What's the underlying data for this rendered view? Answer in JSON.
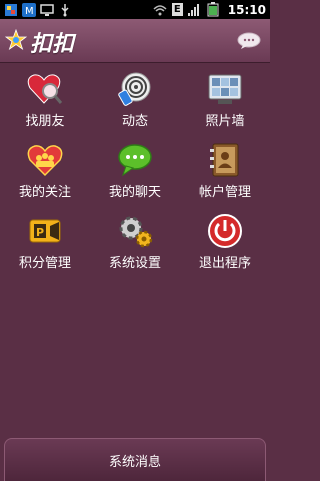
{
  "status_bar": {
    "time": "15:10",
    "left_icons": [
      "app-icon",
      "m-icon",
      "monitor-icon",
      "usb-icon"
    ],
    "right_icons": [
      "wifi-icon",
      "e-icon",
      "signal-icon",
      "battery-icon"
    ],
    "e_label": "E"
  },
  "header": {
    "title": "扣扣",
    "accent": "#6a3a54"
  },
  "menu": [
    {
      "label": "找朋友",
      "icon": "heart-search-icon"
    },
    {
      "label": "动态",
      "icon": "activity-icon"
    },
    {
      "label": "照片墙",
      "icon": "photo-wall-icon"
    },
    {
      "label": "我的关注",
      "icon": "follow-heart-icon"
    },
    {
      "label": "我的聊天",
      "icon": "chat-bubble-icon"
    },
    {
      "label": "帐户管理",
      "icon": "address-book-icon"
    },
    {
      "label": "积分管理",
      "icon": "points-icon"
    },
    {
      "label": "系统设置",
      "icon": "settings-gears-icon"
    },
    {
      "label": "退出程序",
      "icon": "power-icon"
    }
  ],
  "footer": {
    "label": "系统消息"
  }
}
